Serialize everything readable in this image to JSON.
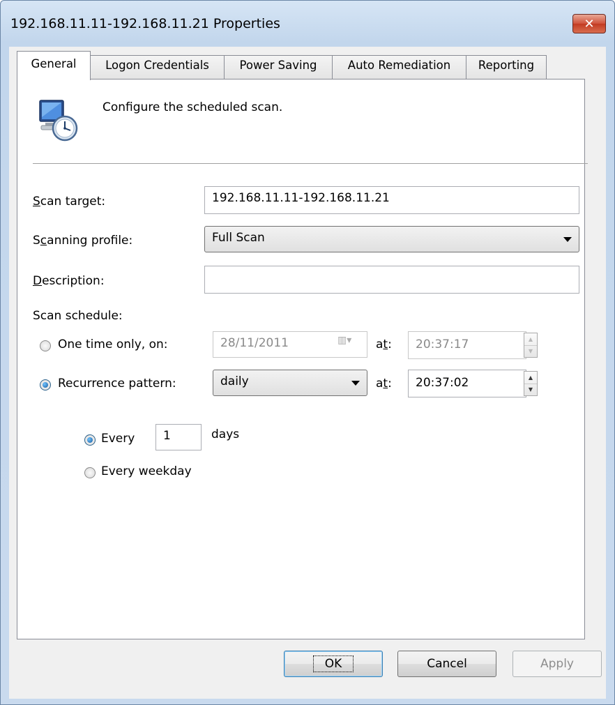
{
  "window": {
    "title": "192.168.11.11-192.168.11.21 Properties"
  },
  "tabs": [
    {
      "label": "General",
      "active": true
    },
    {
      "label": "Logon Credentials",
      "active": false
    },
    {
      "label": "Power Saving",
      "active": false
    },
    {
      "label": "Auto Remediation",
      "active": false
    },
    {
      "label": "Reporting",
      "active": false
    }
  ],
  "general": {
    "intro": "Configure the scheduled scan.",
    "scan_target": {
      "label_key": "S",
      "label_rest": "can target:",
      "value": "192.168.11.11-192.168.11.21"
    },
    "scanning_profile": {
      "label_pre": "S",
      "label_key": "c",
      "label_rest": "anning profile:",
      "value": "Full Scan"
    },
    "description": {
      "label_key": "D",
      "label_rest": "escription:",
      "value": ""
    },
    "scan_schedule_label": "Scan schedule:",
    "one_time": {
      "label": "One time only, on:",
      "date": "28/11/2011",
      "at_pre": "a",
      "at_key": "t",
      "at_post": ":",
      "time": "20:37:17",
      "checked": false
    },
    "recurrence": {
      "label": "Recurrence pattern:",
      "value": "daily",
      "at_pre": "a",
      "at_key": "t",
      "at_post": ":",
      "time": "20:37:02",
      "checked": true
    },
    "every": {
      "label": "Every",
      "value": "1",
      "unit": "days",
      "checked": true
    },
    "every_weekday": {
      "label": "Every weekday",
      "checked": false
    }
  },
  "buttons": {
    "ok": "OK",
    "cancel": "Cancel",
    "apply": "Apply"
  }
}
